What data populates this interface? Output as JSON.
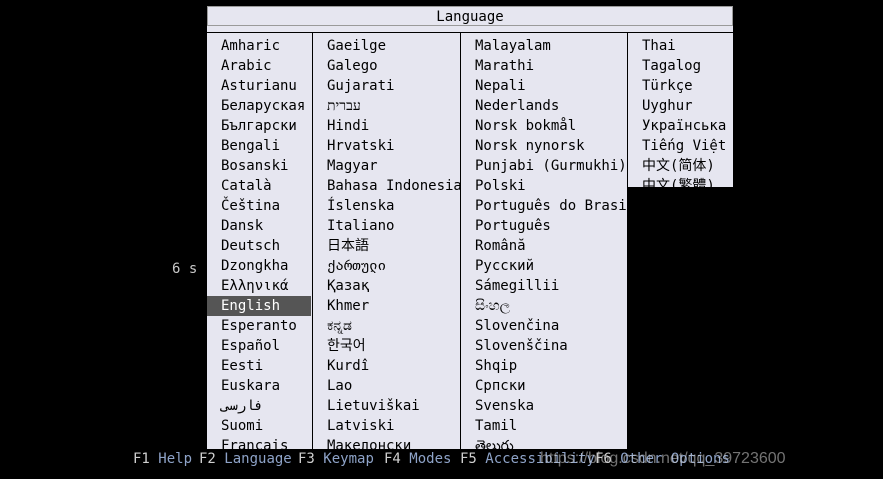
{
  "menu": {
    "title": "Language",
    "columns": [
      [
        "Amharic",
        "Arabic",
        "Asturianu",
        "Беларуская",
        "Български",
        "Bengali",
        "Bosanski",
        "Català",
        "Čeština",
        "Dansk",
        "Deutsch",
        "Dzongkha",
        "Ελληνικά",
        "English",
        "Esperanto",
        "Español",
        "Eesti",
        "Euskara",
        "فارسی",
        "Suomi",
        "Français"
      ],
      [
        "Gaeilge",
        "Galego",
        "Gujarati",
        "עברית",
        "Hindi",
        "Hrvatski",
        "Magyar",
        "Bahasa Indonesia",
        "Íslenska",
        "Italiano",
        "日本語",
        "ქართული",
        "Қазақ",
        "Khmer",
        "ಕನ್ನಡ",
        "한국어",
        "Kurdî",
        "Lao",
        "Lietuviškai",
        "Latviski",
        "Македонски"
      ],
      [
        "Malayalam",
        "Marathi",
        "Nepali",
        "Nederlands",
        "Norsk bokmål",
        "Norsk nynorsk",
        "Punjabi (Gurmukhi)",
        "Polski",
        "Português do Brasil",
        "Português",
        "Română",
        "Русский",
        "Sámegillii",
        "සිංහල",
        "Slovenčina",
        "Slovenščina",
        "Shqip",
        "Српски",
        "Svenska",
        "Tamil",
        "తెలుగు"
      ],
      [
        "Thai",
        "Tagalog",
        "Türkçe",
        "Uyghur",
        "Українська",
        "Tiếng Việt",
        "中文(简体)",
        "中文(繁體)"
      ]
    ],
    "selected": "English"
  },
  "timer": "6 s",
  "footer": [
    {
      "key": "F1",
      "label": "Help"
    },
    {
      "key": "F2",
      "label": "Language"
    },
    {
      "key": "F3",
      "label": "Keymap"
    },
    {
      "key": "F4",
      "label": "Modes"
    },
    {
      "key": "F5",
      "label": "Accessibility"
    },
    {
      "key": "F6",
      "label": "Other Options"
    }
  ],
  "watermark": "https://blog.csdn.net/qq_39723600",
  "colors": {
    "background": "#000000",
    "menu_bg": "#e6e6f0",
    "selected_bg": "#555555",
    "footer_label": "#8ea3c8"
  }
}
